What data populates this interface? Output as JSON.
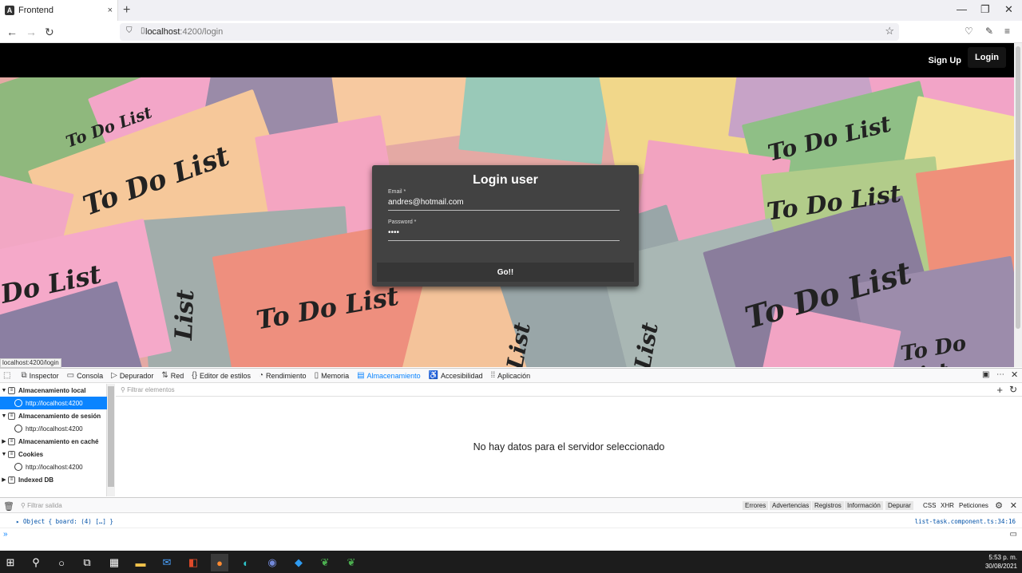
{
  "browser": {
    "tab_title": "Frontend",
    "tab_close": "×",
    "new_tab": "+",
    "url_host": "localhost",
    "url_path": ":4200/login",
    "status_url": "localhost:4200/login"
  },
  "app": {
    "nav": {
      "signup": "Sign Up",
      "login": "Login"
    },
    "card": {
      "title": "Login user",
      "email_label": "Email *",
      "email_value": "andres@hotmail.com",
      "password_label": "Password *",
      "password_value": "••••",
      "submit": "Go!!"
    },
    "bg_notes": [
      "To Do List",
      "To Do List",
      "To Do List",
      "To Do List",
      "To Do List",
      "To Do List",
      "To Do List",
      "Do List",
      "List",
      "List",
      "List"
    ]
  },
  "devtools": {
    "tabs": [
      {
        "label": "Inspector",
        "icon": "⧉"
      },
      {
        "label": "Consola",
        "icon": "▭"
      },
      {
        "label": "Depurador",
        "icon": "▷"
      },
      {
        "label": "Red",
        "icon": "⇅"
      },
      {
        "label": "Editor de estilos",
        "icon": "{}"
      },
      {
        "label": "Rendimiento",
        "icon": "◔"
      },
      {
        "label": "Memoria",
        "icon": "▯"
      },
      {
        "label": "Almacenamiento",
        "icon": "▤"
      },
      {
        "label": "Accesibilidad",
        "icon": "♿"
      },
      {
        "label": "Aplicación",
        "icon": "⁞⁞"
      }
    ],
    "active_tab": "Almacenamiento",
    "tree": [
      {
        "label": "Almacenamiento local",
        "kind": "group"
      },
      {
        "label": "http://localhost:4200",
        "kind": "item",
        "selected": true
      },
      {
        "label": "Almacenamiento de sesión",
        "kind": "group"
      },
      {
        "label": "http://localhost:4200",
        "kind": "item"
      },
      {
        "label": "Almacenamiento en caché",
        "kind": "group"
      },
      {
        "label": "Cookies",
        "kind": "group"
      },
      {
        "label": "http://localhost:4200",
        "kind": "item"
      },
      {
        "label": "Indexed DB",
        "kind": "group"
      }
    ],
    "filter_placeholder": "Filtrar elementos",
    "empty_message": "No hay datos para el servidor seleccionado",
    "console": {
      "filter_placeholder": "Filtrar salida",
      "levels": [
        "Errores",
        "Advertencias",
        "Registros",
        "Información",
        "Depurar"
      ],
      "extra": [
        "CSS",
        "XHR",
        "Peticiones"
      ],
      "log_text": "▸ Object { board: (4) […] }",
      "log_source": "list-task.component.ts:34:16",
      "prompt": "»"
    }
  },
  "taskbar": {
    "time": "5:53 p. m.",
    "date": "30/08/2021"
  }
}
